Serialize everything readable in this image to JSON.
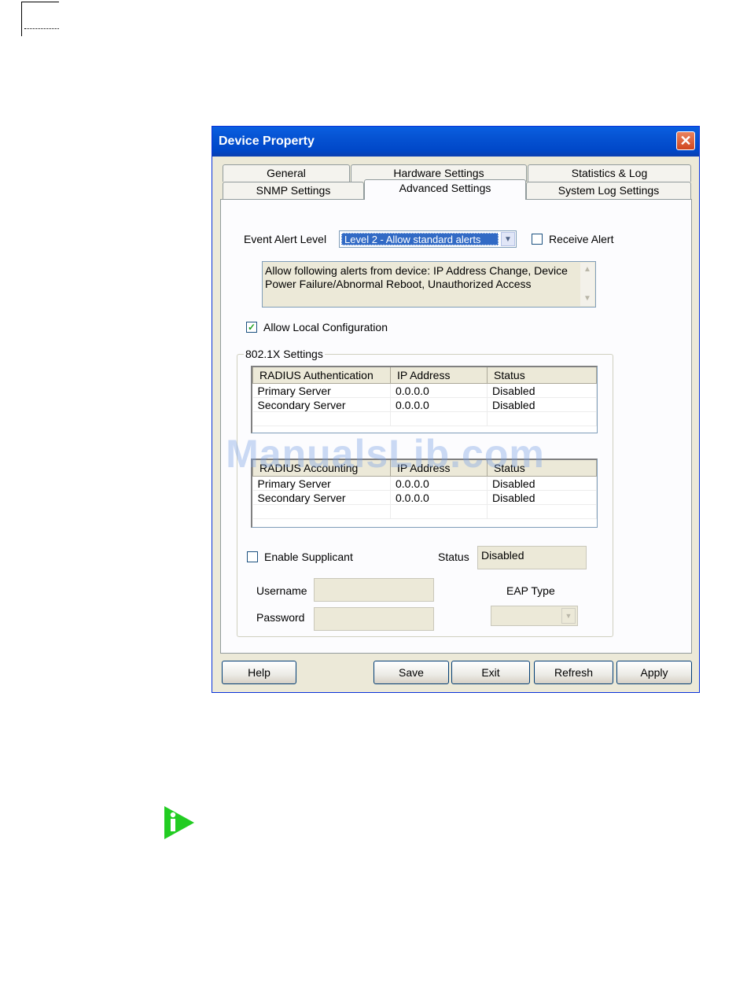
{
  "window": {
    "title": "Device Property",
    "close_glyph": "✕"
  },
  "tabs": {
    "row1": [
      "General",
      "Hardware Settings",
      "Statistics & Log"
    ],
    "row2": [
      "SNMP Settings",
      "Advanced Settings",
      "System Log Settings"
    ],
    "active": "Advanced Settings"
  },
  "event_alert": {
    "label": "Event Alert Level",
    "selected": "Level 2 - Allow standard alerts",
    "receive_alert_label": "Receive Alert",
    "receive_alert_checked": false,
    "description": "Allow following alerts from device: IP Address Change, Device Power Failure/Abnormal Reboot, Unauthorized Access"
  },
  "local_config": {
    "label": "Allow Local Configuration",
    "checked": true,
    "check_glyph": "✓"
  },
  "settings_8021x": {
    "legend": "802.1X Settings",
    "auth_table": {
      "headers": [
        "RADIUS Authentication",
        "IP Address",
        "Status"
      ],
      "rows": [
        [
          "Primary Server",
          "0.0.0.0",
          "Disabled"
        ],
        [
          "Secondary Server",
          "0.0.0.0",
          "Disabled"
        ]
      ]
    },
    "acct_table": {
      "headers": [
        "RADIUS Accounting",
        "IP Address",
        "Status"
      ],
      "rows": [
        [
          "Primary Server",
          "0.0.0.0",
          "Disabled"
        ],
        [
          "Secondary Server",
          "0.0.0.0",
          "Disabled"
        ]
      ]
    },
    "supplicant": {
      "label": "Enable Supplicant",
      "checked": false,
      "status_label": "Status",
      "status_value": "Disabled",
      "username_label": "Username",
      "username_value": "",
      "password_label": "Password",
      "password_value": "",
      "eap_label": "EAP Type",
      "eap_value": ""
    }
  },
  "buttons": {
    "help": "Help",
    "save": "Save",
    "exit": "Exit",
    "refresh": "Refresh",
    "apply": "Apply"
  },
  "watermark": "ManualsLib.com",
  "icons": {
    "info": "info-icon",
    "close": "close-icon",
    "dropdown": "chevron-down-icon"
  },
  "colors": {
    "titlebar": "#0552d2",
    "selection": "#316ac5",
    "info_icon": "#22cc22"
  }
}
